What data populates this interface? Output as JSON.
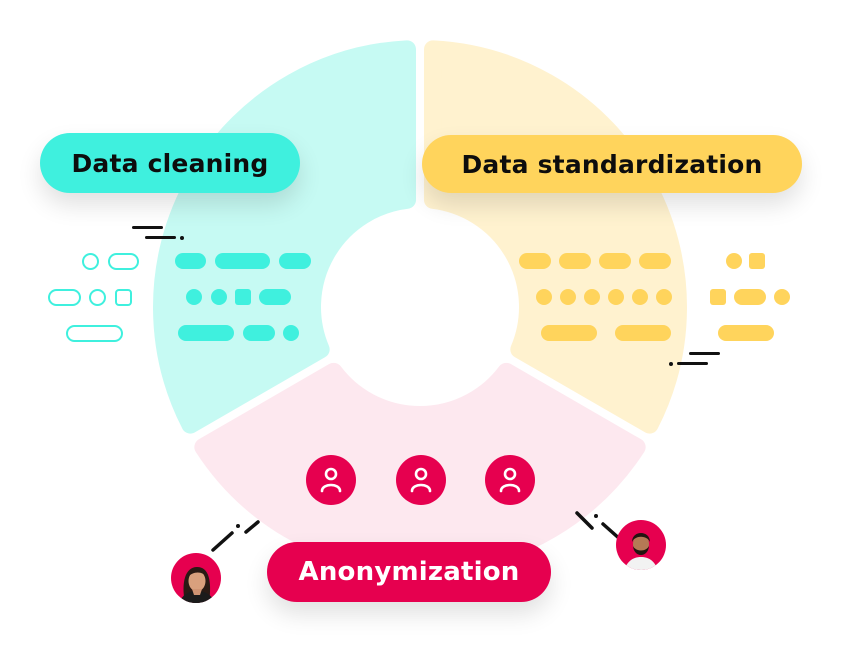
{
  "diagram": {
    "title_segments": [
      {
        "id": "cleaning",
        "label": "Data cleaning",
        "color": "#3ff0de",
        "tint": "#c6faf3"
      },
      {
        "id": "standardization",
        "label": "Data standardization",
        "color": "#ffd45c",
        "tint": "#fff2cf"
      },
      {
        "id": "anonymization",
        "label": "Anonymization",
        "color": "#e6004f",
        "tint": "#fde8ef"
      }
    ],
    "anonymization": {
      "user_icons": [
        "user-icon",
        "user-icon",
        "user-icon"
      ],
      "avatars": [
        "woman-avatar",
        "man-avatar"
      ]
    }
  },
  "colors": {
    "teal": "#3ff0de",
    "teal_tint": "#c6faf3",
    "yellow": "#ffd45c",
    "yellow_tint": "#fff2cf",
    "pink": "#e6004f",
    "pink_tint": "#fde8ef",
    "ink": "#111111"
  }
}
